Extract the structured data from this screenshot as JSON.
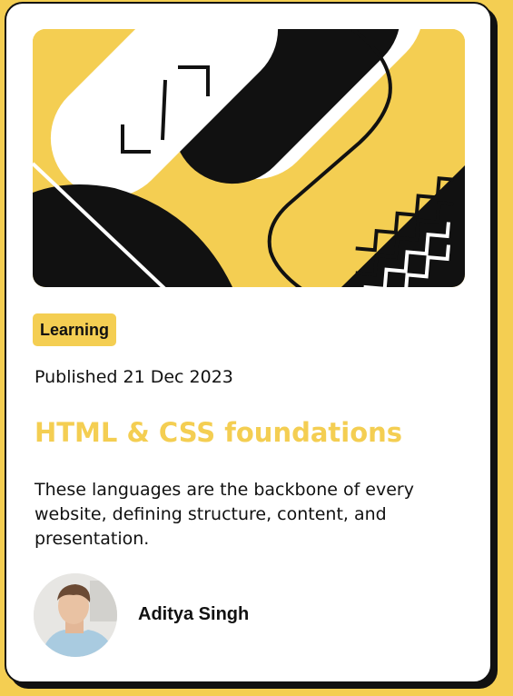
{
  "card": {
    "category": "Learning",
    "published": "Published 21 Dec 2023",
    "title": "HTML & CSS foundations",
    "description": "These languages are the backbone of every website, defining structure, content, and presentation.",
    "author": {
      "name": "Aditya Singh",
      "avatar_icon": "person-photo"
    },
    "illustration_icon": "abstract-geometric-illustration"
  },
  "colors": {
    "accent": "#F4CE52",
    "dark": "#111111",
    "background": "#FFFFFF"
  }
}
